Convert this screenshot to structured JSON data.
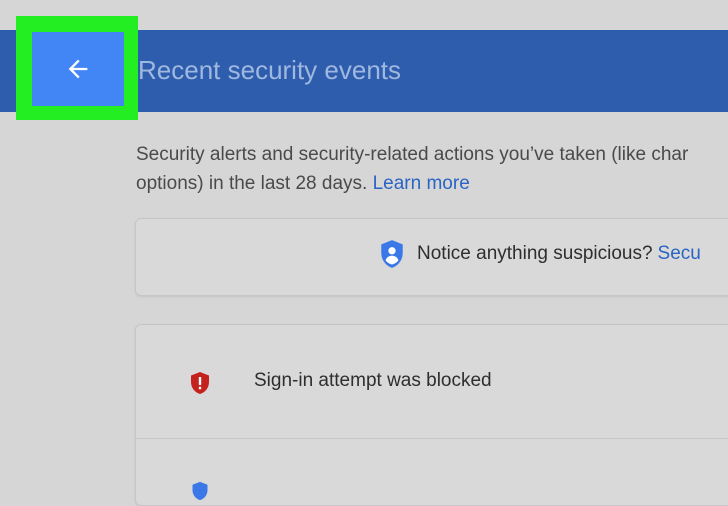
{
  "header": {
    "title": "Recent security events",
    "back_icon": "arrow-back-icon",
    "highlight_color": "#22ee22",
    "bar_color": "#2f5dad",
    "back_button_color": "#4285f4"
  },
  "description": {
    "line1": "Security alerts and security-related actions you’ve taken (like char",
    "line2_text": "options) in the last 28 days.",
    "learn_more": "Learn more"
  },
  "notice": {
    "icon": "shield-person-icon",
    "text": "Notice anything suspicious?",
    "link": "Secu"
  },
  "events": [
    {
      "icon": "shield-alert-icon",
      "text": "Sign-in attempt was blocked",
      "icon_color": "#c5221f"
    },
    {
      "icon": "shield-icon",
      "icon_color": "#3b78e7"
    }
  ]
}
